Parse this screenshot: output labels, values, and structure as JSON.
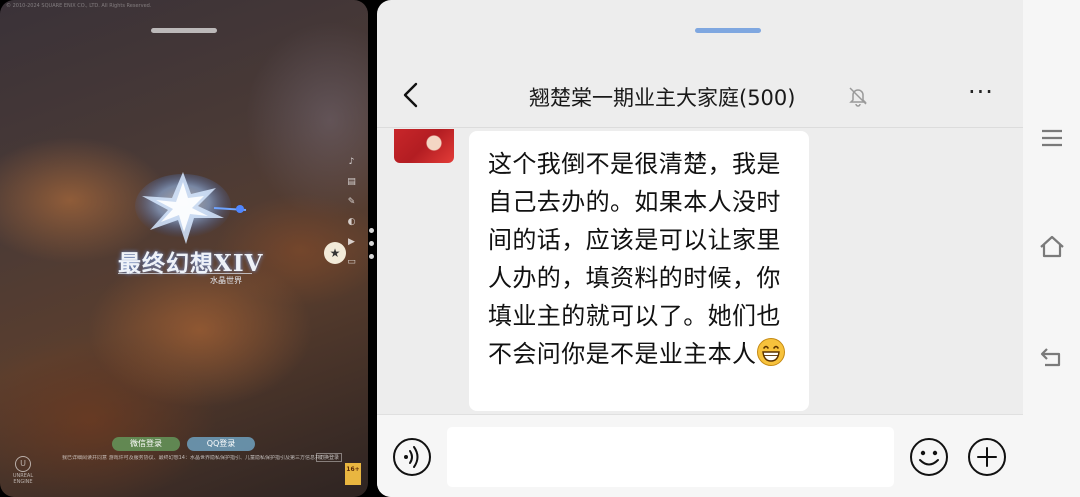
{
  "game": {
    "top_fine_print": "© 2010-2024 SQUARE ENIX CO., LTD. All Rights Reserved.",
    "logo_title": "最终幻想XIV",
    "logo_subtitle": "水晶世界",
    "wechat_login": "微信登录",
    "qq_login": "QQ登录",
    "agreement": "我已详细阅读并同意 游戏许可及服务协议、最终幻想14：水晶世界隐私保护指引、儿童隐私保护指引及第三方信息共享清单",
    "engine_label": "UNREAL ENGINE",
    "switch_account": "切换登录",
    "age_rating": "16+",
    "side_icons": [
      "speaker-icon",
      "clipboard-icon",
      "wrench-icon",
      "contrast-icon",
      "video-icon",
      "card-icon"
    ]
  },
  "chat": {
    "title": "翘楚棠一期业主大家庭(500)",
    "more_label": "···",
    "message_text": "这个我倒不是很清楚，我是自己去办的。如果本人没时间的话，应该是可以让家里人办的，填资料的时候，你填业主的就可以了。她们也不会问你是不是业主本人",
    "message_emoji": "grinning-emoji",
    "input_value": ""
  },
  "system_nav": [
    "menu-icon",
    "home-icon",
    "back-icon"
  ],
  "colors": {
    "chat_bg": "#ededed",
    "bubble_bg": "#ffffff",
    "handle_accent": "#7fa7e0",
    "wechat_green": "#6aa05a",
    "emoji_yellow": "#f7c23c"
  }
}
